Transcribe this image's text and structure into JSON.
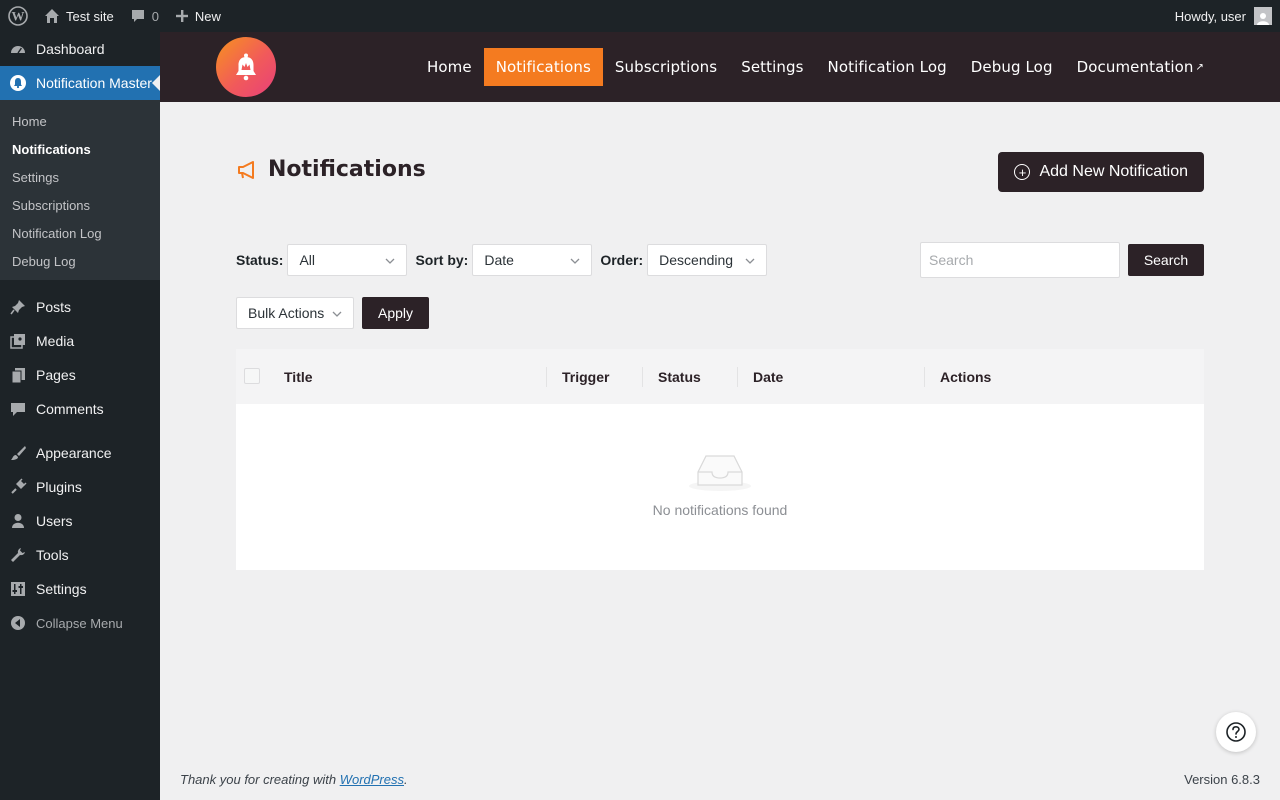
{
  "admin_bar": {
    "site_name": "Test site",
    "comments_count": "0",
    "new_label": "New",
    "greeting": "Howdy, user",
    "icons": [
      "wordpress-logo-icon",
      "home-icon",
      "comment-icon",
      "plus-icon",
      "avatar"
    ]
  },
  "sidebar": {
    "dashboard": "Dashboard",
    "current_menu": "Notification Master",
    "submenu": [
      "Home",
      "Notifications",
      "Settings",
      "Subscriptions",
      "Notification Log",
      "Debug Log"
    ],
    "active_submenu": "Notifications",
    "menu": [
      "Posts",
      "Media",
      "Pages",
      "Comments",
      "Appearance",
      "Plugins",
      "Users",
      "Tools",
      "Settings"
    ],
    "collapse": "Collapse Menu"
  },
  "top_nav": {
    "items": [
      "Home",
      "Notifications",
      "Subscriptions",
      "Settings",
      "Notification Log",
      "Debug Log",
      "Documentation"
    ],
    "active": "Notifications",
    "external_mark": "↗"
  },
  "page": {
    "title": "Notifications",
    "add_button": "Add New Notification"
  },
  "filters": {
    "status_label": "Status:",
    "status_value": "All",
    "sort_label": "Sort by:",
    "sort_value": "Date",
    "order_label": "Order:",
    "order_value": "Descending",
    "search_placeholder": "Search",
    "search_button": "Search"
  },
  "bulk": {
    "select_value": "Bulk Actions",
    "apply": "Apply"
  },
  "table": {
    "columns": [
      "Title",
      "Trigger",
      "Status",
      "Date",
      "Actions"
    ],
    "empty_text": "No notifications found"
  },
  "footer": {
    "thanks_prefix": "Thank you for creating with ",
    "thanks_link": "WordPress",
    "thanks_suffix": ".",
    "version": "Version 6.8.3"
  },
  "colors": {
    "accent": "#f47b20",
    "dark": "#2c2227",
    "wp_blue": "#2271b1"
  }
}
